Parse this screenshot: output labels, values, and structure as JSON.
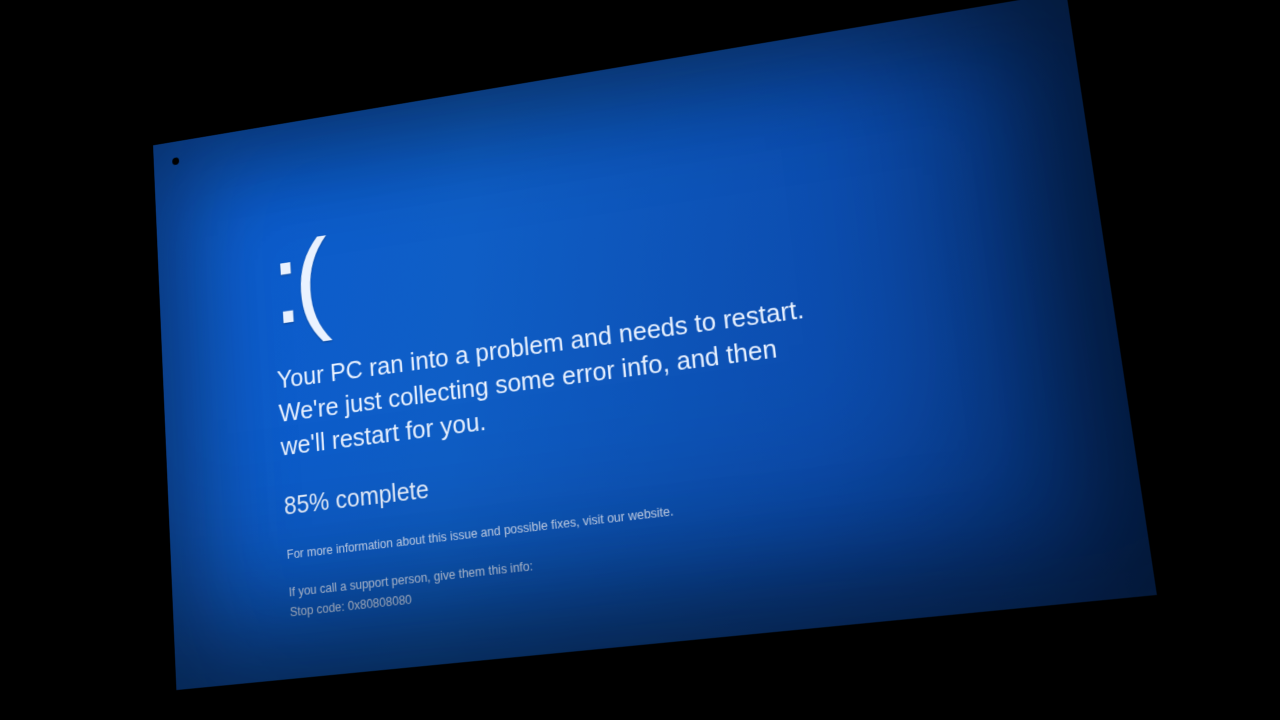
{
  "bsod": {
    "face": ":(",
    "message": "Your PC ran into a problem and needs to restart. We're just collecting some error info, and then we'll restart for you.",
    "progress": "85% complete",
    "info_line": "For more information about this issue and possible fixes, visit our website.",
    "support_line": "If you call a support person, give them this info:",
    "stopcode_line": "Stop code: 0x80808080"
  },
  "colors": {
    "background": "#000000",
    "screen_blue": "#0c52bd"
  }
}
